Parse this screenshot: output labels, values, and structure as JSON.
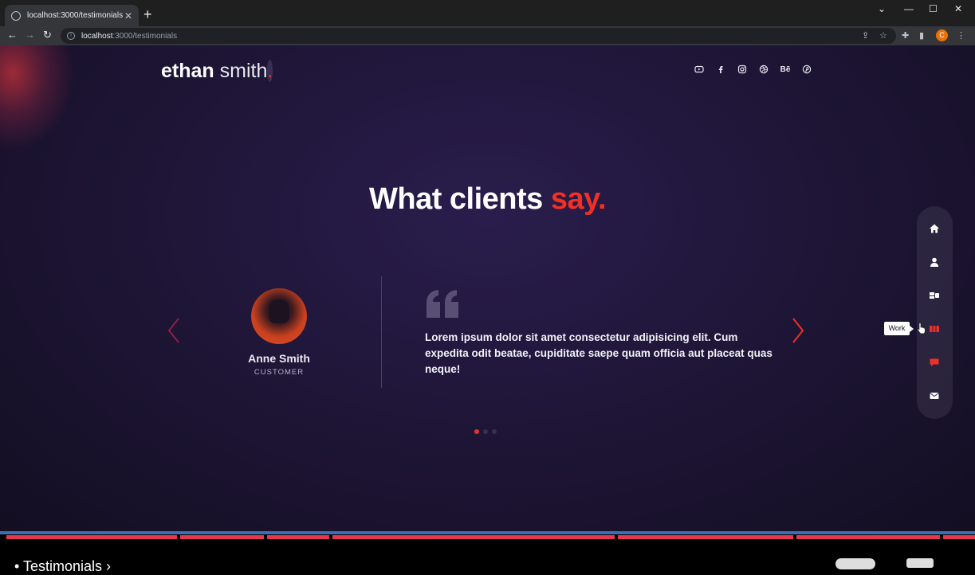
{
  "browser": {
    "tab_title": "localhost:3000/testimonials",
    "url_host": "localhost",
    "url_path": ":3000/testimonials",
    "profile_initial": "C"
  },
  "site": {
    "logo_bold": "ethan",
    "logo_light": "smith",
    "logo_dot": ".",
    "socials": [
      "youtube-icon",
      "facebook-icon",
      "instagram-icon",
      "dribbble-icon",
      "behance-icon",
      "pinterest-icon"
    ],
    "behance_text": "Bē"
  },
  "section": {
    "heading_main": "What clients",
    "heading_accent": "say."
  },
  "testimonial": {
    "name": "Anne Smith",
    "role": "CUSTOMER",
    "quote": "Lorem ipsum dolor sit amet consectetur adipisicing elit. Cum expedita odit beatae, cupiditate saepe quam officia aut placeat quas neque!",
    "active_slide": 1,
    "slide_count": 3
  },
  "sidenav": {
    "items": [
      "home-icon",
      "about-icon",
      "services-icon",
      "work-icon",
      "testimonials-icon",
      "contact-icon"
    ],
    "tooltip": "Work"
  },
  "player": {
    "chapter": "Testimonials"
  },
  "colors": {
    "accent": "#f13024",
    "background": "#1f1638"
  }
}
